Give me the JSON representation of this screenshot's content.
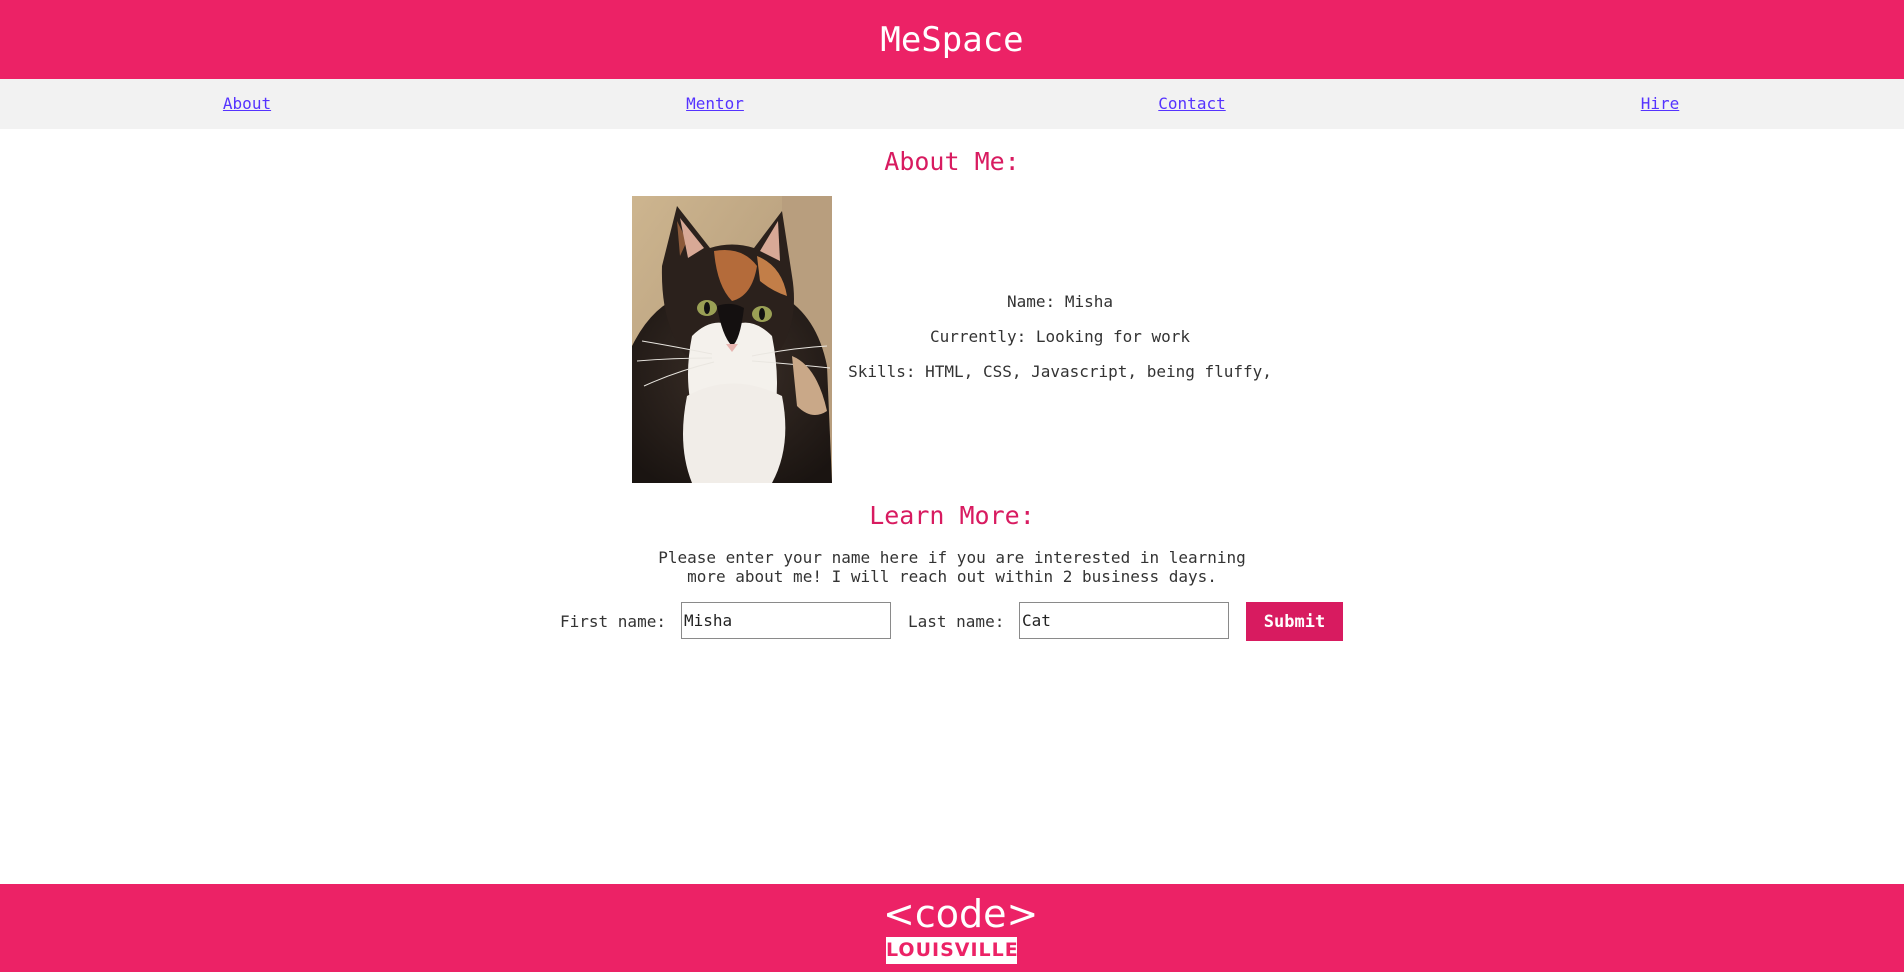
{
  "header": {
    "title": "MeSpace"
  },
  "nav": {
    "items": [
      {
        "label": "About"
      },
      {
        "label": "Mentor"
      },
      {
        "label": "Contact"
      },
      {
        "label": "Hire"
      }
    ]
  },
  "about": {
    "heading": "About Me:",
    "photo_icon": "calico-cat-photo",
    "name_line": "Name: Misha",
    "currently_line": "Currently: Looking for work",
    "skills_line": "Skills: HTML, CSS, Javascript, being fluffy,"
  },
  "learn_more": {
    "heading": "Learn More:",
    "description_line1": "Please enter your name here if you are interested in learning",
    "description_line2": "more about me! I will reach out within 2 business days.",
    "first_name_label": "First name:",
    "first_name_value": "Misha",
    "last_name_label": "Last name:",
    "last_name_value": "Cat",
    "submit_label": "Submit"
  },
  "footer": {
    "logo_top": "<code>",
    "logo_bottom": "LOUISVILLE"
  },
  "colors": {
    "brand_pink": "#ec2266",
    "accent_pink": "#d81b60",
    "nav_bg": "#f2f2f2",
    "link_blue": "#5533ff"
  }
}
